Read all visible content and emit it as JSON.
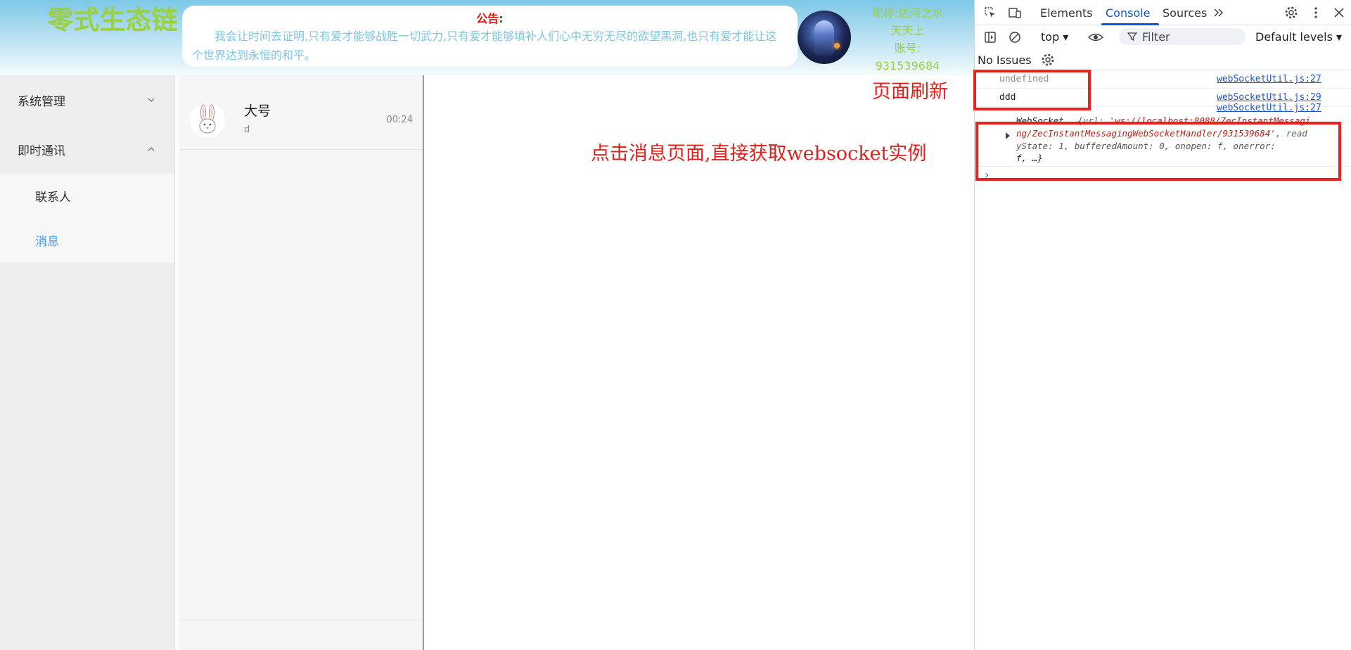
{
  "header": {
    "brand": "零式生态链",
    "notice_title": "公告:",
    "notice_text": "我会让时间去证明,只有爱才能够战胜一切武力,只有爱才能够填补人们心中无穷无尽的欲望黑洞,也只有爱才能让这个世界达到永恒的和平。",
    "user_nickname_line1": "昵称:达河之水",
    "user_nickname_line2": "天天上",
    "user_account_label": "账号:",
    "user_account": "931539684"
  },
  "sidebar": {
    "groups": [
      {
        "label": "系统管理",
        "expanded": false
      },
      {
        "label": "即时通讯",
        "expanded": true
      }
    ],
    "sub_items": [
      {
        "label": "联系人",
        "active": false
      },
      {
        "label": "消息",
        "active": true
      }
    ]
  },
  "conversations": [
    {
      "name": "大号",
      "last_message": "d",
      "time": "00:24"
    }
  ],
  "annotations": {
    "refresh": "页面刷新",
    "click": "点击消息页面,直接获取websocket实例"
  },
  "devtools": {
    "tabs": [
      "Elements",
      "Console",
      "Sources"
    ],
    "active_tab": "Console",
    "context": "top",
    "filter_placeholder": "Filter",
    "levels": "Default levels",
    "issues": "No Issues",
    "logs": [
      {
        "text": "undefined",
        "source": "webSocketUtil.js:27",
        "muted": true
      },
      {
        "text": "ddd",
        "source": "webSocketUtil.js:29",
        "muted": false
      }
    ],
    "ws_source": "webSocketUtil.js:27",
    "ws_line1_a": "WebSocket",
    "ws_line1_b": "{url: ",
    "ws_line1_c": "'ws://localhost:8088/ZecInstantMessagi",
    "ws_line2_a": "ng/ZecInstantMessagingWebSocketHandler/931539684'",
    "ws_line2_b": ", read",
    "ws_line3": "yState: 1, bufferedAmount: 0, onopen: f, onerror:",
    "ws_line4": "f, …}"
  },
  "colors": {
    "brand_green": "#9bd03f",
    "notice_red": "#e01010",
    "notice_text": "#7cc4e0",
    "active_blue": "#409eff",
    "annotation_red": "#e0201c",
    "devtools_blue": "#0b57d0"
  }
}
